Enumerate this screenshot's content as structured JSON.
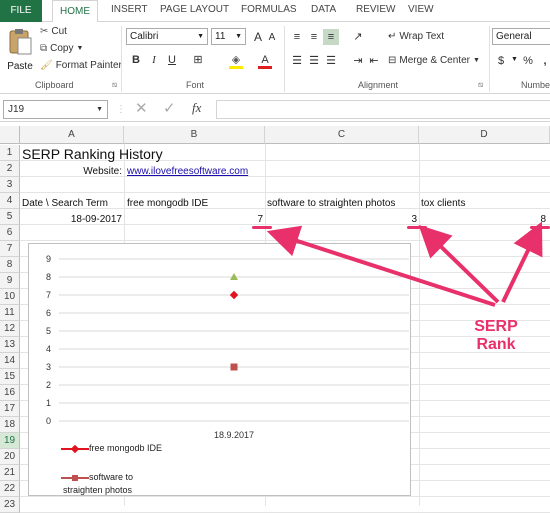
{
  "ribbon_tabs": {
    "file": "FILE",
    "home": "HOME",
    "insert": "INSERT",
    "page_layout": "PAGE LAYOUT",
    "formulas": "FORMULAS",
    "data": "DATA",
    "review": "REVIEW",
    "view": "VIEW"
  },
  "clipboard": {
    "paste": "Paste",
    "cut": "Cut",
    "copy": "Copy",
    "format_painter": "Format Painter",
    "label": "Clipboard"
  },
  "font": {
    "name": "Calibri",
    "size": "11",
    "bold": "B",
    "italic": "I",
    "underline": "U",
    "label": "Font",
    "grow": "A",
    "shrink": "A"
  },
  "alignment": {
    "wrap_text": "Wrap Text",
    "merge_center": "Merge & Center",
    "label": "Alignment"
  },
  "number": {
    "format": "General",
    "percent": "%",
    "comma": ",",
    "label": "Numbe"
  },
  "formula_bar": {
    "name_box": "J19",
    "fx": "fx",
    "value": ""
  },
  "columns": [
    "A",
    "B",
    "C",
    "D"
  ],
  "rows": [
    "1",
    "2",
    "3",
    "4",
    "5",
    "6",
    "7",
    "8",
    "9",
    "10",
    "11",
    "12",
    "13",
    "14",
    "15",
    "16",
    "17",
    "18",
    "19",
    "20",
    "21",
    "22",
    "23"
  ],
  "cells": {
    "a1": "SERP Ranking History",
    "a2": "Website:",
    "b2": "www.ilovefreesoftware.com",
    "a4": "Date \\ Search Term",
    "b4": "free mongodb IDE",
    "c4": "software to straighten photos",
    "d4": "tox clients",
    "a5": "18-09-2017",
    "b5": "7",
    "c5": "3",
    "d5": "8"
  },
  "chart_data": {
    "type": "scatter",
    "categories": [
      "18.9.2017"
    ],
    "ylim": [
      0,
      9
    ],
    "yticks": [
      "0",
      "1",
      "2",
      "3",
      "4",
      "5",
      "6",
      "7",
      "8",
      "9"
    ],
    "series": [
      {
        "name": "free mongodb IDE",
        "values": [
          7
        ],
        "color": "#e0141e",
        "marker": "diamond"
      },
      {
        "name": "software to straighten photos",
        "values": [
          3
        ],
        "color": "#c0504d",
        "marker": "square"
      },
      {
        "name": "tox clients",
        "values": [
          8
        ],
        "color": "#9bbb59",
        "marker": "triangle"
      }
    ],
    "legend": [
      "free mongodb IDE",
      "software to",
      "straighten photos"
    ]
  },
  "annotation": {
    "line1": "SERP",
    "line2": "Rank",
    "color": "#e8306a"
  }
}
